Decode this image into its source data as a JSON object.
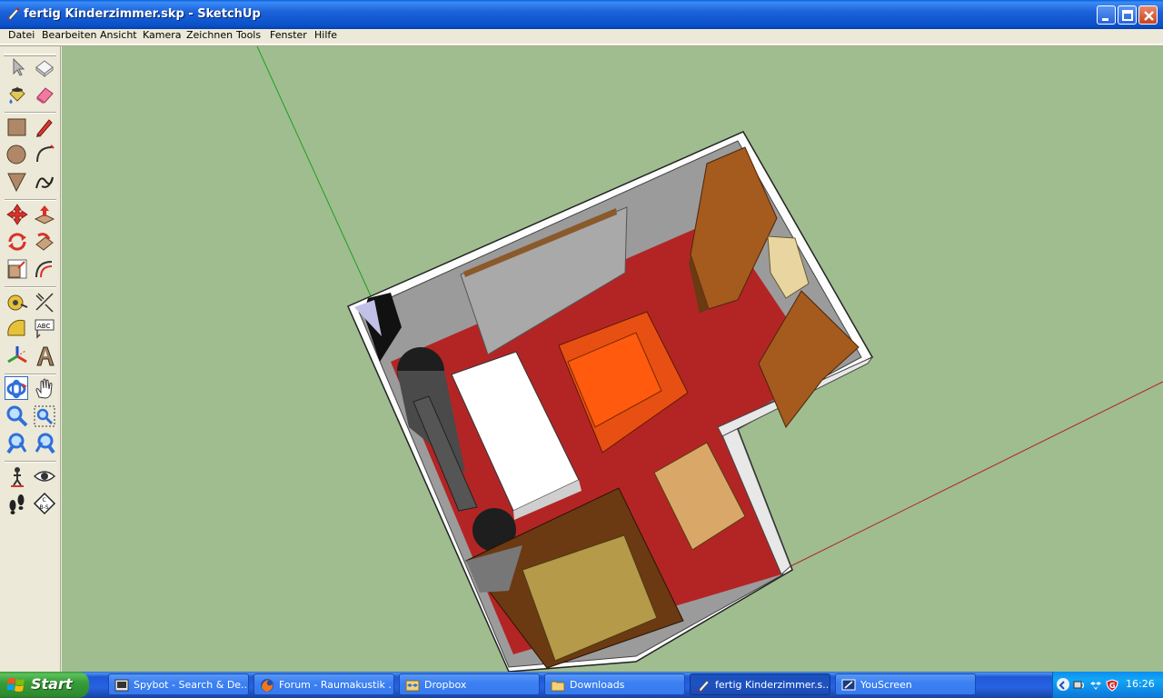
{
  "window": {
    "title": "fertig Kinderzimmer.skp - SketchUp",
    "controls": [
      "minimize",
      "maximize",
      "close"
    ]
  },
  "menu": {
    "items": [
      "Datei",
      "Bearbeiten",
      "Ansicht",
      "Kamera",
      "Zeichnen",
      "Tools",
      "Fenster",
      "Hilfe"
    ]
  },
  "toolbar": {
    "tools": [
      {
        "name": "select-tool",
        "icon": "arrow-icon"
      },
      {
        "name": "make-component-tool",
        "icon": "component-icon"
      },
      {
        "name": "paint-bucket-tool",
        "icon": "paint-bucket-icon"
      },
      {
        "name": "eraser-tool",
        "icon": "eraser-icon"
      },
      {
        "name": "rectangle-tool",
        "icon": "rectangle-icon"
      },
      {
        "name": "line-tool",
        "icon": "pencil-icon"
      },
      {
        "name": "circle-tool",
        "icon": "circle-icon"
      },
      {
        "name": "arc-tool",
        "icon": "arc-icon"
      },
      {
        "name": "polygon-tool",
        "icon": "polygon-icon"
      },
      {
        "name": "freehand-tool",
        "icon": "freehand-icon"
      },
      {
        "name": "move-tool",
        "icon": "move-icon"
      },
      {
        "name": "push-pull-tool",
        "icon": "push-pull-icon"
      },
      {
        "name": "rotate-tool",
        "icon": "rotate-icon"
      },
      {
        "name": "follow-me-tool",
        "icon": "follow-me-icon"
      },
      {
        "name": "scale-tool",
        "icon": "scale-icon"
      },
      {
        "name": "offset-tool",
        "icon": "offset-icon"
      },
      {
        "name": "tape-measure-tool",
        "icon": "tape-measure-icon"
      },
      {
        "name": "dimension-tool",
        "icon": "dimension-icon"
      },
      {
        "name": "protractor-tool",
        "icon": "protractor-icon"
      },
      {
        "name": "text-tool",
        "icon": "text-label-icon"
      },
      {
        "name": "axes-tool",
        "icon": "axes-icon"
      },
      {
        "name": "3d-text-tool",
        "icon": "3d-text-icon"
      },
      {
        "name": "orbit-tool",
        "icon": "orbit-icon"
      },
      {
        "name": "pan-tool",
        "icon": "hand-icon"
      },
      {
        "name": "zoom-tool",
        "icon": "magnifier-icon"
      },
      {
        "name": "zoom-window-tool",
        "icon": "zoom-window-icon"
      },
      {
        "name": "previous-view-tool",
        "icon": "previous-view-icon"
      },
      {
        "name": "next-view-tool",
        "icon": "next-view-icon"
      },
      {
        "name": "position-camera-tool",
        "icon": "position-camera-icon"
      },
      {
        "name": "look-around-tool",
        "icon": "eye-icon"
      },
      {
        "name": "walk-tool",
        "icon": "footprints-icon"
      },
      {
        "name": "section-plane-tool",
        "icon": "section-plane-icon"
      }
    ],
    "text_tool_badge": "ABC",
    "section_badge": "C\nB-S",
    "active_tool": "orbit-tool"
  },
  "viewport": {
    "background": "#9fbd8f",
    "axis_colors": {
      "green": "#1ea01e",
      "red": "#b22222"
    },
    "model": "Kinderzimmer floor plan (3D)"
  },
  "taskbar": {
    "start_label": "Start",
    "tasks": [
      {
        "label": "Spybot - Search & De...",
        "icon": "spybot-icon",
        "active": false
      },
      {
        "label": "Forum - Raumakustik ...",
        "icon": "firefox-icon",
        "active": false
      },
      {
        "label": "Dropbox",
        "icon": "dropbox-icon",
        "active": false
      },
      {
        "label": "Downloads",
        "icon": "folder-icon",
        "active": false
      },
      {
        "label": "fertig Kinderzimmer.s...",
        "icon": "sketchup-icon",
        "active": true
      },
      {
        "label": "YouScreen",
        "icon": "youscreen-icon",
        "active": false
      }
    ],
    "clock": "16:26"
  }
}
